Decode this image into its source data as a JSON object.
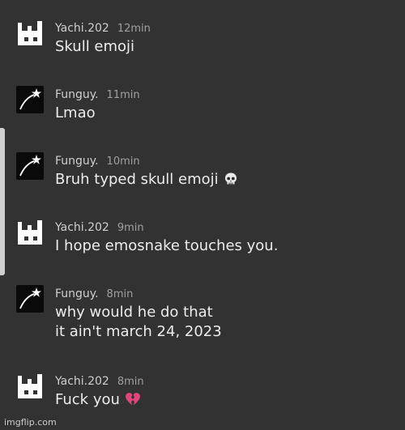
{
  "messages": [
    {
      "avatar": "white-block-avatar-icon",
      "username": "Yachi.202",
      "time": "12min",
      "lines": [
        "Skull emoji"
      ]
    },
    {
      "avatar": "shooting-star-avatar-icon",
      "username": "Funguy.",
      "time": "11min",
      "lines": [
        "Lmao"
      ]
    },
    {
      "avatar": "shooting-star-avatar-icon",
      "username": "Funguy.",
      "time": "10min",
      "lines": [
        "Bruh typed skull emoji"
      ],
      "emoji": "skull-emoji-icon"
    },
    {
      "avatar": "white-block-avatar-icon",
      "username": "Yachi.202",
      "time": "9min",
      "lines": [
        "I hope emosnake touches you."
      ]
    },
    {
      "avatar": "shooting-star-avatar-icon",
      "username": "Funguy.",
      "time": "8min",
      "lines": [
        "why would he do that",
        "it ain't march 24, 2023"
      ]
    },
    {
      "avatar": "white-block-avatar-icon",
      "username": "Yachi.202",
      "time": "8min",
      "lines": [
        "Fuck you"
      ],
      "emoji": "broken-heart-emoji-icon"
    }
  ],
  "watermark": "imgflip.com",
  "colors": {
    "background": "#323232",
    "username": "#cfcfcf",
    "timestamp": "#a0a0a0",
    "message_text": "#ececec",
    "broken_heart": "#e0457b"
  }
}
